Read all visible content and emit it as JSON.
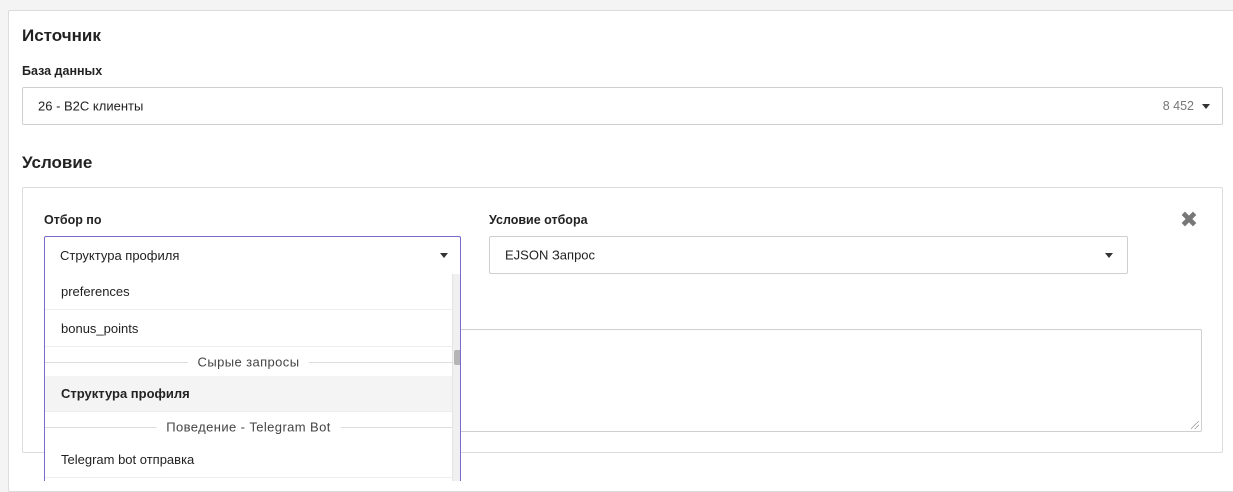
{
  "source": {
    "heading": "Источник",
    "database_label": "База данных",
    "database_value": "26 - B2C клиенты",
    "database_count": "8 452"
  },
  "condition": {
    "heading": "Условие",
    "filter_by_label": "Отбор по",
    "filter_by_value": "Структура профиля",
    "criteria_label": "Условие отбора",
    "criteria_value": "EJSON Запрос"
  },
  "dropdown": {
    "options": [
      {
        "label": "preferences"
      },
      {
        "label": "bonus_points"
      }
    ],
    "group1": "Сырые запросы",
    "selected_option": "Структура профиля",
    "group2": "Поведение - Telegram Bot",
    "option_after": "Telegram bot отправка"
  },
  "colors": {
    "focus_border": "#7b68c8",
    "selected_bg": "#f4f4f5"
  }
}
